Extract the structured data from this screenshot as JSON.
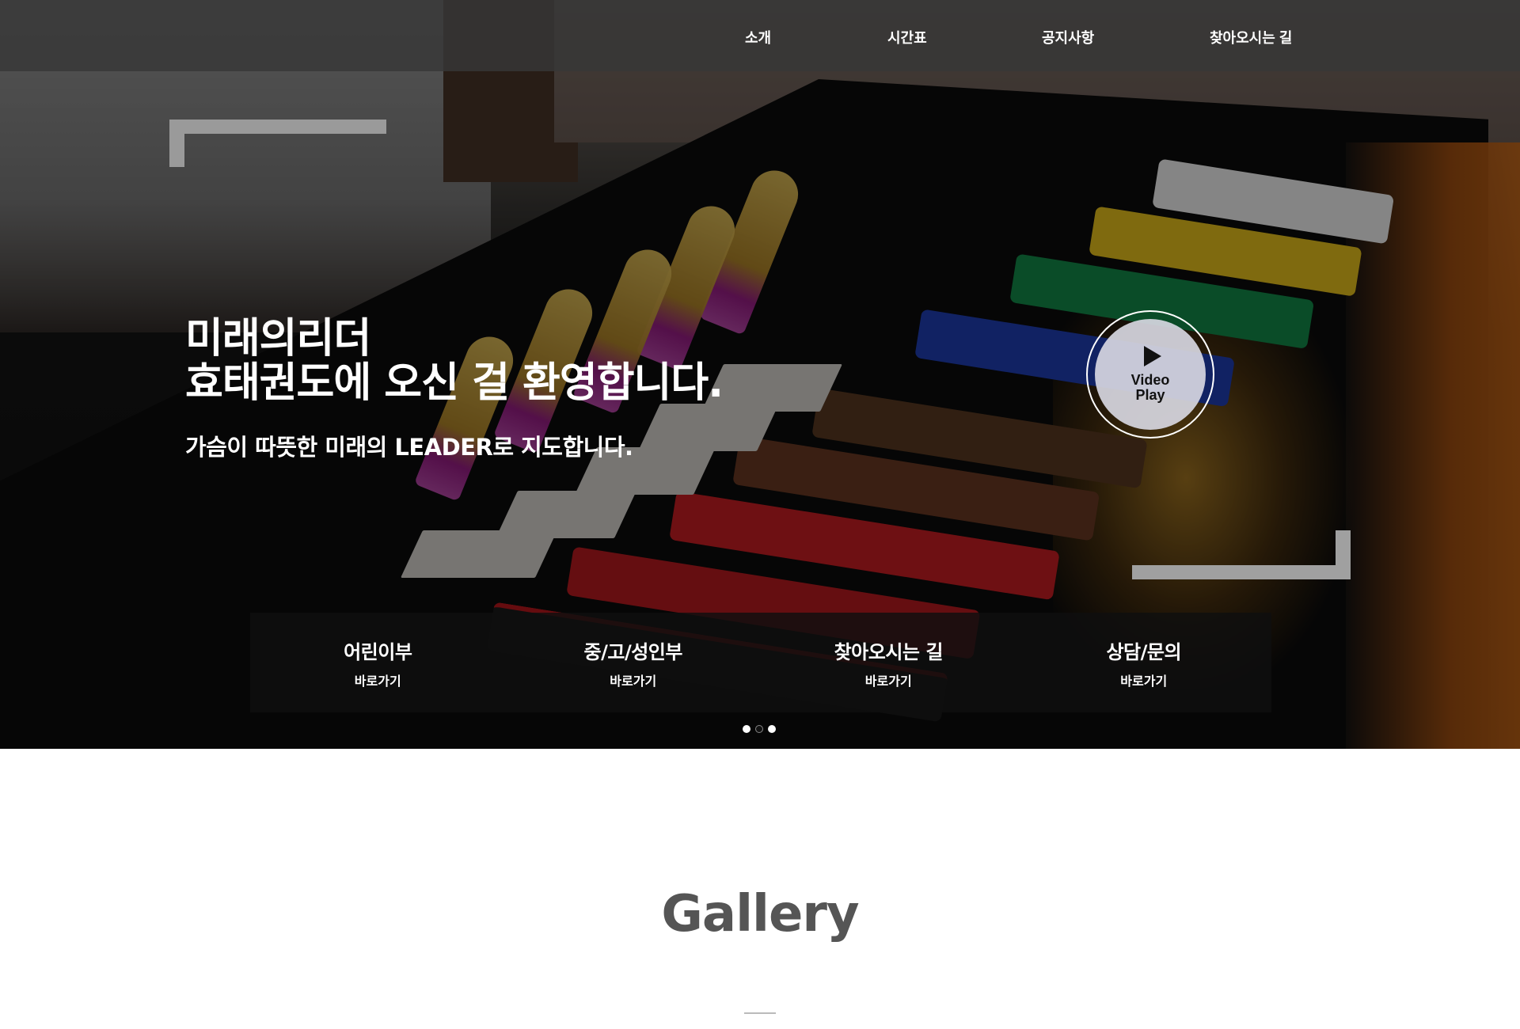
{
  "nav": {
    "items": [
      {
        "label": "소개"
      },
      {
        "label": "시간표"
      },
      {
        "label": "공지사항"
      },
      {
        "label": "찾아오시는 길"
      }
    ]
  },
  "hero": {
    "headline_line1": "미래의리더",
    "headline_line2": "효태권도에 오신 걸 환영합니다.",
    "subheadline": "가슴이 따뜻한 미래의 LEADER로 지도합니다.",
    "video_button": {
      "line1": "Video",
      "line2": "Play",
      "icon": "play-icon"
    },
    "quick_links": [
      {
        "title": "어린이부",
        "sub": "바로가기"
      },
      {
        "title": "중/고/성인부",
        "sub": "바로가기"
      },
      {
        "title": "찾아오시는 길",
        "sub": "바로가기"
      },
      {
        "title": "상담/문의",
        "sub": "바로가기"
      }
    ],
    "slider": {
      "total": 3,
      "active_index": 1
    }
  },
  "gallery": {
    "title": "Gallery"
  },
  "colors": {
    "topbar": "#373737",
    "heading_text": "#555555",
    "belt_colors": [
      "#f2f2f2",
      "#e8c21c",
      "#138a4a",
      "#1f3fb5",
      "#5a3a22",
      "#c81e24",
      "#1a1a1a"
    ]
  }
}
